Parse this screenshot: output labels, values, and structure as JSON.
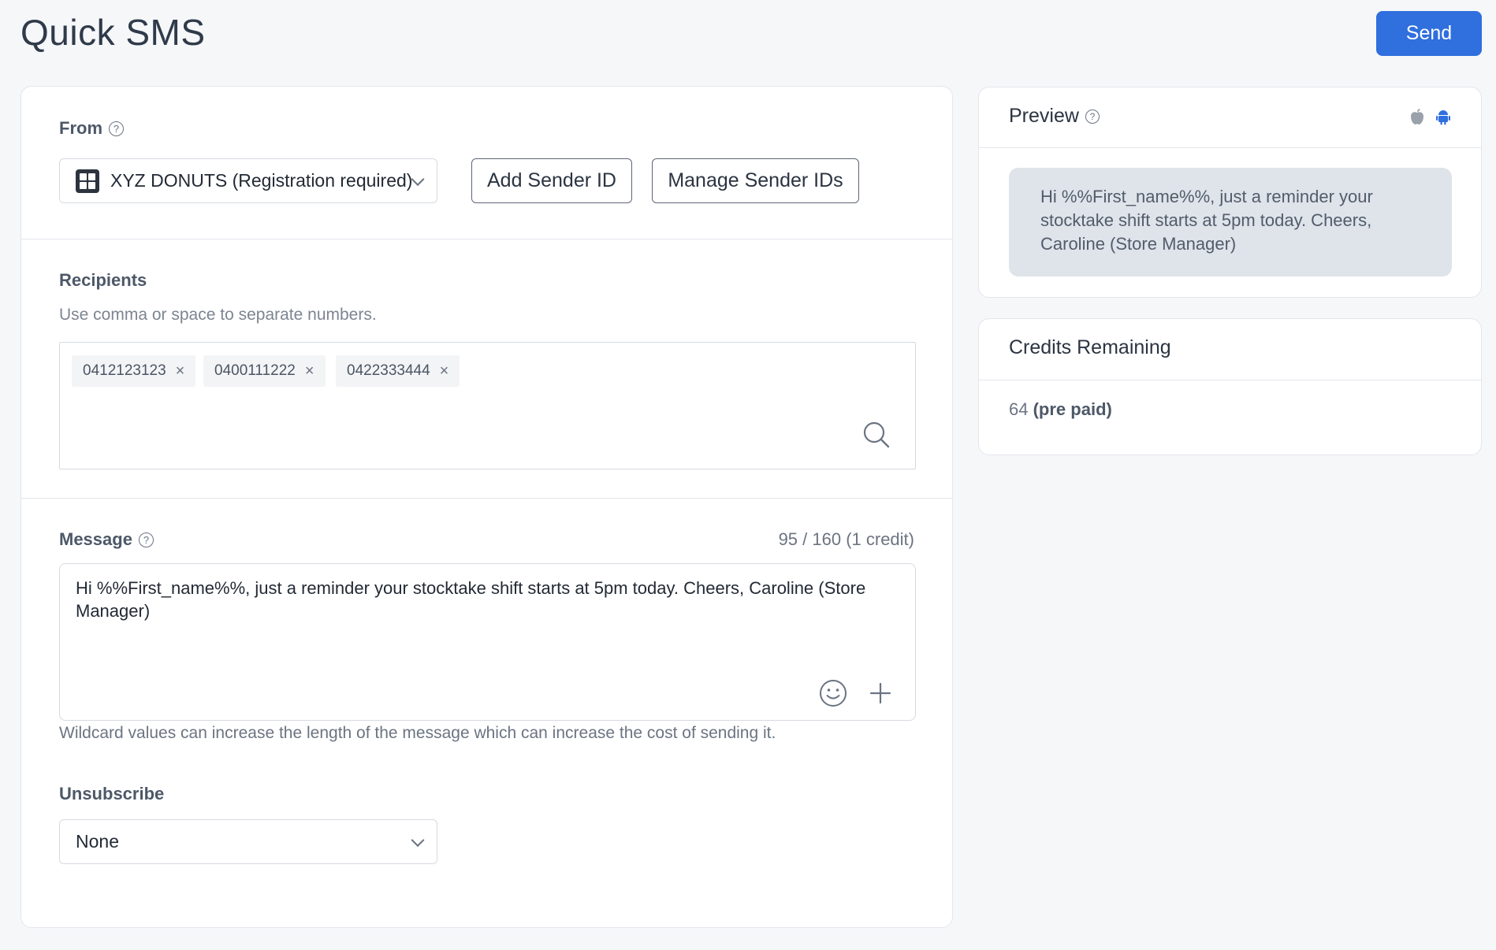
{
  "page": {
    "title": "Quick SMS"
  },
  "actions": {
    "send_label": "Send"
  },
  "from": {
    "label": "From",
    "help": "?",
    "sender_value": "XYZ DONUTS (Registration required)",
    "add_sender_label": "Add Sender ID",
    "manage_sender_label": "Manage Sender IDs"
  },
  "recipients": {
    "label": "Recipients",
    "hint": "Use comma or space to separate numbers.",
    "tags": [
      "0412123123",
      "0400111222",
      "0422333444"
    ],
    "remove_glyph": "×"
  },
  "message": {
    "label": "Message",
    "help": "?",
    "counter": "95 / 160 (1 credit)",
    "text": "Hi %%First_name%%, just a reminder your stocktake shift starts at 5pm today. Cheers, Caroline (Store Manager)",
    "wildcard_note": "Wildcard values can increase the length of the message which can increase the cost of sending it."
  },
  "unsubscribe": {
    "label": "Unsubscribe",
    "value": "None"
  },
  "preview": {
    "title": "Preview",
    "help": "?",
    "bubble_text": "Hi %%First_name%%, just a reminder your stocktake shift starts at 5pm today. Cheers, Caroline (Store Manager)",
    "os_icons": [
      "apple-icon",
      "android-icon"
    ],
    "active_os_color": "#2f6fde"
  },
  "credits": {
    "title": "Credits Remaining",
    "amount": "64",
    "type": "(pre paid)"
  },
  "colors": {
    "accent": "#2f6fde",
    "bubble": "#dfe3ea"
  }
}
